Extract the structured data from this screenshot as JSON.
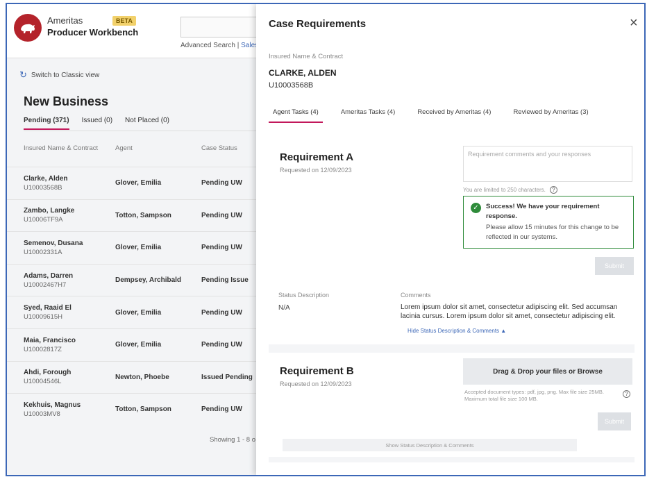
{
  "app": {
    "brand_name": "Ameritas",
    "brand_sub": "Producer Workbench",
    "beta": "BETA",
    "adv_search": "Advanced Search",
    "adv_sep": " | ",
    "sales": "Sales",
    "classic_view": "Switch to Classic view"
  },
  "new_business": {
    "title": "New Business",
    "tabs": [
      {
        "label": "Pending (371)"
      },
      {
        "label": "Issued (0)"
      },
      {
        "label": "Not Placed (0)"
      }
    ],
    "columns": [
      "Insured Name & Contract",
      "Agent",
      "Case Status"
    ],
    "rows": [
      {
        "name": "Clarke, Alden",
        "contract": "U10003568B",
        "agent": "Glover, Emilia",
        "status": "Pending UW"
      },
      {
        "name": "Zambo, Langke",
        "contract": "U10006TF9A",
        "agent": "Totton, Sampson",
        "status": "Pending UW"
      },
      {
        "name": "Semenov, Dusana",
        "contract": "U10002331A",
        "agent": "Glover, Emilia",
        "status": "Pending UW"
      },
      {
        "name": "Adams, Darren",
        "contract": "U10002467H7",
        "agent": "Dempsey, Archibald",
        "status": "Pending Issue"
      },
      {
        "name": "Syed, Raaid El",
        "contract": "U10009615H",
        "agent": "Glover, Emilia",
        "status": "Pending UW"
      },
      {
        "name": "Maia, Francisco",
        "contract": "U10002817Z",
        "agent": "Glover, Emilia",
        "status": "Pending UW"
      },
      {
        "name": "Ahdi, Forough",
        "contract": "U10004546L",
        "agent": "Newton, Phoebe",
        "status": "Issued Pending"
      },
      {
        "name": "Kekhuis, Magnus",
        "contract": "U10003MV8",
        "agent": "Totton, Sampson",
        "status": "Pending UW"
      }
    ],
    "showing": "Showing 1 - 8 o"
  },
  "drawer": {
    "title": "Case Requirements",
    "close": "×",
    "insured_label": "Insured Name & Contract",
    "insured_name": "CLARKE, ALDEN",
    "insured_contract": "U10003568B",
    "tabs": [
      {
        "label": "Agent Tasks (4)"
      },
      {
        "label": "Ameritas Tasks (4)"
      },
      {
        "label": "Received by Ameritas (4)"
      },
      {
        "label": "Reviewed by Ameritas (3)"
      }
    ],
    "req_a": {
      "title": "Requirement A",
      "date": "Requested on 12/09/2023",
      "placeholder": "Requirement comments and your responses",
      "limit": "You are limited to 250 characters.",
      "success_head": "Success! We have your requirement response.",
      "success_body": "Please allow 15 minutes for this change to be reflected in our systems.",
      "submit": "Submit",
      "status_label": "Status Description",
      "status_value": "N/A",
      "comments_label": "Comments",
      "comments_value": "Lorem ipsum dolor sit amet, consectetur adipiscing elit. Sed accumsan lacinia cursus. Lorem ipsum dolor sit amet, consectetur adipiscing elit.",
      "show_more": "Hide Status Description & Comments ▲"
    },
    "req_b": {
      "title": "Requirement B",
      "date": "Requested on 12/09/2023",
      "dropzone": "Drag & Drop your files or Browse",
      "drop_note": "Accepted document types: pdf, jpg, png. Max file size 25MB. Maximum total file size 100 MB.",
      "submit": "Submit",
      "footer": "Show Status Description & Comments"
    }
  },
  "colors": {
    "accent": "#c2185b",
    "brand_red": "#b4232b",
    "frame_blue": "#3c67b7",
    "success_green": "#2e8b3a"
  }
}
